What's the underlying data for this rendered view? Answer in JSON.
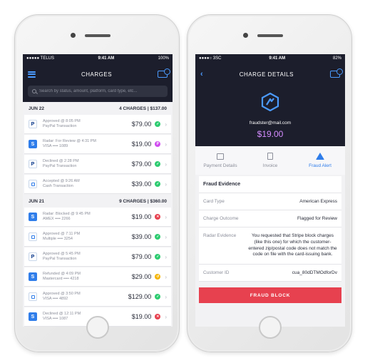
{
  "left": {
    "status": {
      "carrier": "●●●●● TELUS",
      "time": "9:41 AM",
      "battery": "100%"
    },
    "title": "CHARGES",
    "search_placeholder": "Search by status, amount, platform, card type, etc...",
    "groups": [
      {
        "date": "JUN 22",
        "summary": "4 CHARGES | $137.00",
        "rows": [
          {
            "brand": "paypal",
            "line1": "Approved @ 8:05 PM",
            "line2": "PayPal Transaction",
            "amount": "$79.00",
            "status": "ok"
          },
          {
            "brand": "stripe",
            "line1": "Radar: For Review @ 4:31 PM",
            "line2": "VISA •••• 1089",
            "amount": "$19.00",
            "status": "review"
          },
          {
            "brand": "paypal",
            "line1": "Declined @ 2:28 PM",
            "line2": "PayPal Transaction",
            "amount": "$79.00",
            "status": "ok"
          },
          {
            "brand": "square",
            "line1": "Accepted @ 9:26 AM",
            "line2": "Cash Transaction",
            "amount": "$39.00",
            "status": "ok"
          }
        ]
      },
      {
        "date": "JUN 21",
        "summary": "9 CHARGES | $360.00",
        "rows": [
          {
            "brand": "stripe",
            "line1": "Radar: Blocked @ 9:45 PM",
            "line2": "AMEX •••• 2266",
            "amount": "$19.00",
            "status": "blocked"
          },
          {
            "brand": "square",
            "line1": "Approved @ 7:11 PM",
            "line2": "Multiple •••• 3254",
            "amount": "$39.00",
            "status": "ok"
          },
          {
            "brand": "paypal",
            "line1": "Approved @ 5:45 PM",
            "line2": "PayPal Transaction",
            "amount": "$79.00",
            "status": "ok"
          },
          {
            "brand": "stripe",
            "line1": "Refunded @ 4:09 PM",
            "line2": "Mastercard •••• 4218",
            "amount": "$29.00",
            "status": "refunded"
          },
          {
            "brand": "square",
            "line1": "Approved @ 3:50 PM",
            "line2": "VISA •••• 4892",
            "amount": "$129.00",
            "status": "ok"
          },
          {
            "brand": "stripe",
            "line1": "Declined @ 12:11 PM",
            "line2": "VISA •••• 1087",
            "amount": "$19.00",
            "status": "blocked"
          }
        ]
      }
    ]
  },
  "right": {
    "status": {
      "carrier": "●●●●○ 3SC",
      "time": "9:41 AM",
      "battery": "82%"
    },
    "title": "CHARGE DETAILS",
    "email": "fraudster@mail.com",
    "amount": "$19.00",
    "tabs": [
      {
        "label": "Payment Details",
        "icon": "card-icon"
      },
      {
        "label": "Invoice",
        "icon": "document-icon"
      },
      {
        "label": "Fraud Alert",
        "icon": "warning-icon"
      }
    ],
    "evidence_title": "Fraud Evidence",
    "evidence": [
      {
        "key": "Card Type",
        "value": "American Express"
      },
      {
        "key": "Charge Outcome",
        "value": "Flagged for Review"
      },
      {
        "key": "Radar Evidence",
        "value": "You requested that Stripe block charges (like this one) for which the customer-entered zip/postal code does not match the code on file with the card-issuing bank."
      },
      {
        "key": "Customer ID",
        "value": "cua_80dDTMOdforDv"
      }
    ],
    "button": "FRAUD BLOCK"
  },
  "colors": {
    "header": "#1c1e2c",
    "accent": "#4b9bff",
    "ok": "#2ecc71",
    "review": "#d04cf0",
    "blocked": "#e7414f",
    "refunded": "#f5b400",
    "amount": "#d48cff"
  }
}
